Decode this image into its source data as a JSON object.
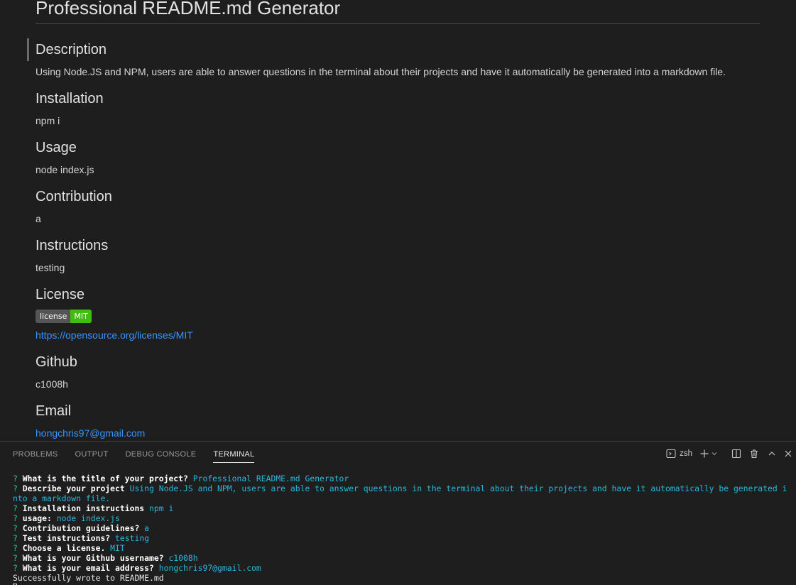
{
  "readme": {
    "title": "Professional README.md Generator",
    "sections": [
      {
        "heading": "Description",
        "text": "Using Node.JS and NPM, users are able to answer questions in the terminal about their projects and have it automatically be generated into a markdown file."
      },
      {
        "heading": "Installation",
        "text": "npm i"
      },
      {
        "heading": "Usage",
        "text": "node index.js"
      },
      {
        "heading": "Contribution",
        "text": "a"
      },
      {
        "heading": "Instructions",
        "text": "testing"
      }
    ],
    "license": {
      "heading": "License",
      "badge_label": "license",
      "badge_value": "MIT",
      "badge_color": "#44bb11",
      "link": "https://opensource.org/licenses/MIT"
    },
    "github": {
      "heading": "Github",
      "text": "c1008h"
    },
    "email": {
      "heading": "Email",
      "link": "hongchris97@gmail.com"
    }
  },
  "panel": {
    "tabs": [
      "PROBLEMS",
      "OUTPUT",
      "DEBUG CONSOLE",
      "TERMINAL"
    ],
    "active_tab": "TERMINAL",
    "shell": "zsh",
    "icons": [
      "terminal-icon",
      "plus-icon",
      "chevron-down-icon",
      "split-icon",
      "trash-icon",
      "chevron-up-icon",
      "close-icon"
    ]
  },
  "terminal": {
    "prompt_symbol": "?",
    "qa": [
      {
        "q": "What is the title of your project?",
        "a": "Professional README.md Generator"
      },
      {
        "q": "Describe your project",
        "a": "Using Node.JS and NPM, users are able to answer questions in the terminal about their projects and have it automatically be generated into a markdown file."
      },
      {
        "q": "Installation instructions",
        "a": "npm i"
      },
      {
        "q": "usage:",
        "a": "node index.js"
      },
      {
        "q": "Contribution guidelines?",
        "a": "a"
      },
      {
        "q": "Test instructions?",
        "a": "testing"
      },
      {
        "q": "Choose a license.",
        "a": "MIT"
      },
      {
        "q": "What is your Github username?",
        "a": "c1008h"
      },
      {
        "q": "What is your email address?",
        "a": "hongchris97@gmail.com"
      }
    ],
    "output": "Successfully wrote to README.md"
  },
  "colors": {
    "link": "#3794ff",
    "terminal_answer": "#29b8db",
    "terminal_prompt": "#23d18b"
  }
}
